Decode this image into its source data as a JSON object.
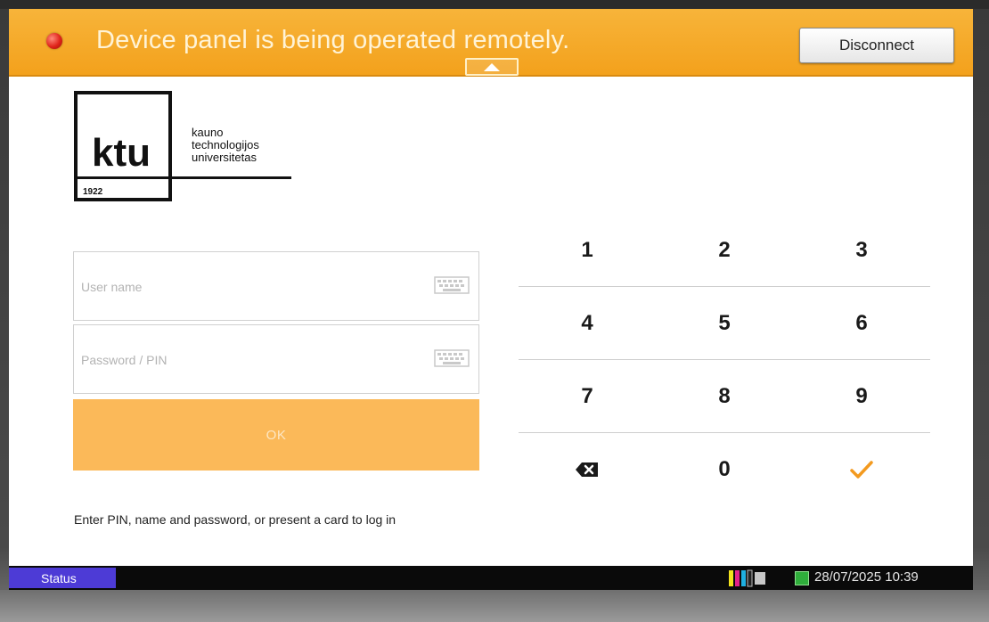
{
  "banner": {
    "message": "Device panel is being operated remotely.",
    "disconnect_label": "Disconnect"
  },
  "logo": {
    "mark": "ktu",
    "year": "1922",
    "name_lines": [
      "kauno",
      "technologijos",
      "universitetas"
    ]
  },
  "login": {
    "username_placeholder": "User name",
    "username_value": "",
    "password_placeholder": "Password / PIN",
    "password_value": "",
    "ok_label": "OK",
    "hint": "Enter PIN, name and password, or present a card to log in"
  },
  "keypad": {
    "keys": [
      "1",
      "2",
      "3",
      "4",
      "5",
      "6",
      "7",
      "8",
      "9",
      "backspace",
      "0",
      "confirm"
    ],
    "confirm_color": "#f39a1f"
  },
  "statusbar": {
    "status_label": "Status",
    "datetime": "28/07/2025 10:39"
  },
  "colors": {
    "banner": "#f3a11c",
    "ok_button": "#fbb959",
    "status_button": "#4d3bd6"
  },
  "icons": {
    "banner_led": "red-status-led-icon",
    "keyboard": "keyboard-icon",
    "backspace": "backspace-icon",
    "confirm": "checkmark-icon",
    "toner": "toner-levels-icon",
    "network": "network-status-icon",
    "collapse": "collapse-arrow-icon"
  }
}
